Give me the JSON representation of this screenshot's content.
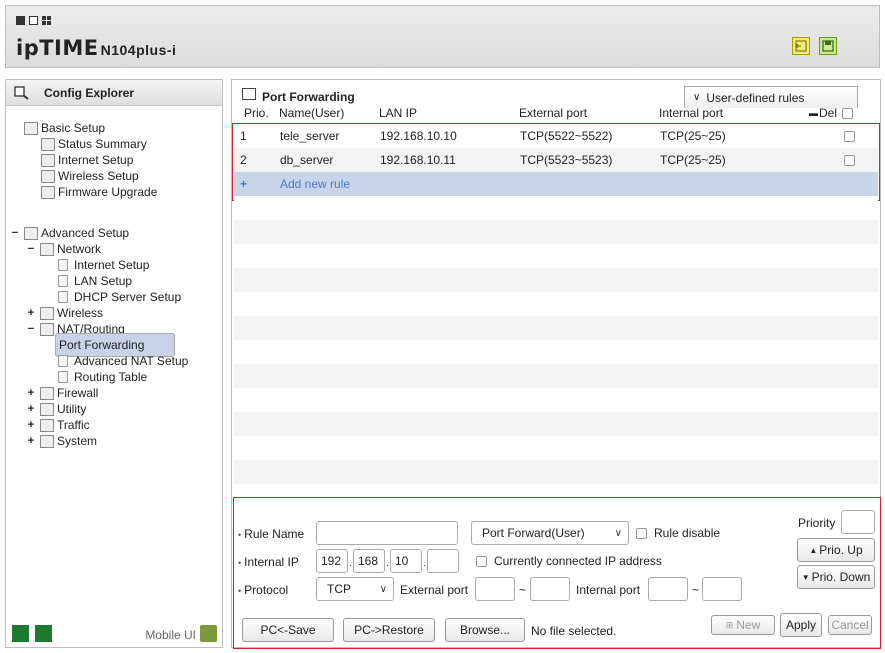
{
  "header": {
    "brand": "ipTIME",
    "model": "N104plus-i"
  },
  "sidebar": {
    "title": "Config Explorer",
    "basic": {
      "label": "Basic Setup",
      "items": [
        "Status Summary",
        "Internet Setup",
        "Wireless Setup",
        "Firmware Upgrade"
      ]
    },
    "advanced": {
      "label": "Advanced Setup",
      "network": {
        "label": "Network",
        "items": [
          "Internet Setup",
          "LAN Setup",
          "DHCP Server Setup"
        ]
      },
      "wireless": "Wireless",
      "nat": {
        "label": "NAT/Routing",
        "items": [
          "Port Forwarding",
          "Advanced NAT Setup",
          "Routing Table"
        ]
      },
      "firewall": "Firewall",
      "utility": "Utility",
      "traffic": "Traffic",
      "system": "System"
    },
    "mobile_ui": "Mobile UI"
  },
  "main": {
    "title": "Port Forwarding",
    "filter_select": "User-defined rules",
    "columns": {
      "prio": "Prio.",
      "name": "Name(User)",
      "lan_ip": "LAN IP",
      "external_port": "External port",
      "internal_port": "Internal port",
      "del": "Del"
    },
    "rules": [
      {
        "prio": "1",
        "name": "tele_server",
        "lan_ip": "192.168.10.10",
        "external_port": "TCP(5522~5522)",
        "internal_port": "TCP(25~25)"
      },
      {
        "prio": "2",
        "name": "db_server",
        "lan_ip": "192.168.10.11",
        "external_port": "TCP(5523~5523)",
        "internal_port": "TCP(25~25)"
      }
    ],
    "add_rule_symbol": "+",
    "add_rule_label": "Add new rule"
  },
  "form": {
    "rule_name_label": "Rule Name",
    "rule_name_value": "",
    "rule_type_select": "Port Forward(User)",
    "rule_disable_label": "Rule disable",
    "priority_label": "Priority",
    "priority_value": "",
    "prio_up": "Prio. Up",
    "prio_down": "Prio. Down",
    "internal_ip_label": "Internal IP",
    "ip": [
      "192",
      "168",
      "10",
      ""
    ],
    "connected_ip_label": "Currently connected IP address",
    "protocol_label": "Protocol",
    "protocol_select": "TCP",
    "external_port_label": "External port",
    "internal_port_label": "Internal port",
    "tilde": "~",
    "pc_save": "PC<-Save",
    "pc_restore": "PC->Restore",
    "browse": "Browse...",
    "no_file": "No file selected.",
    "new": "New",
    "apply": "Apply",
    "cancel": "Cancel"
  },
  "colors": {
    "highlight_red": "#d0202a",
    "selected_tree": "#c8d2e8",
    "add_row_bg": "#c8d4ea",
    "add_row_text": "#4a7acc"
  }
}
